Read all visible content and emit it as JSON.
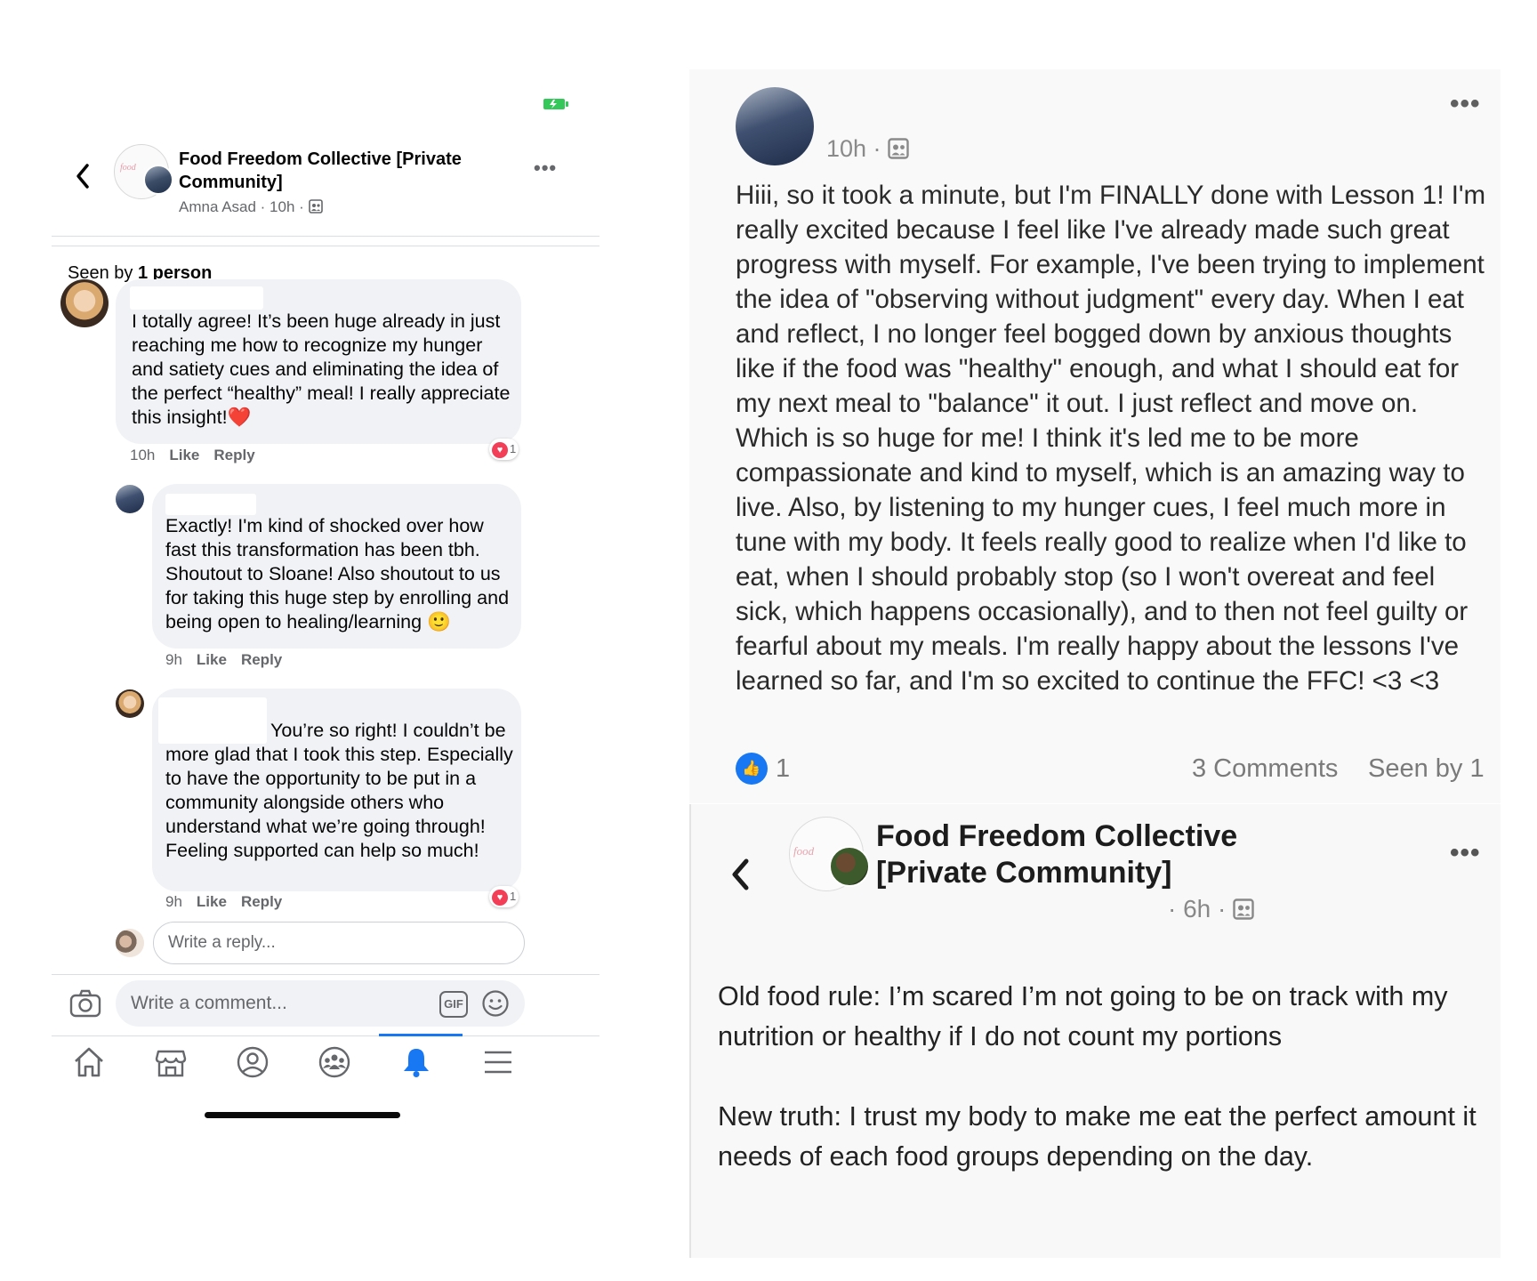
{
  "colors": {
    "accent": "#1877f2",
    "heart": "#f33e58",
    "bubble": "#f0f2f5",
    "secondary_text": "#65676b"
  },
  "left_panel": {
    "header": {
      "group_title": "Food Freedom Collective [Private Community]",
      "meta": "Amna Asad · 10h · ",
      "privacy_icon": "group-members-icon"
    },
    "seen_by": {
      "prefix": "Seen by ",
      "count": "1 person"
    },
    "comments": [
      {
        "text": "I totally agree! It’s been huge already in just reaching me how to recognize my hunger and satiety cues and eliminating the idea of the perfect “healthy” meal! I really appreciate this insight!❤️",
        "time": "10h",
        "like": "Like",
        "reply": "Reply",
        "reaction_count": "1"
      },
      {
        "text": "Exactly! I'm kind of shocked over how fast this transformation has been tbh. Shoutout to Sloane! Also shoutout to us for taking this huge step by enrolling and being open to healing/learning 🙂",
        "time": "9h",
        "like": "Like",
        "reply": "Reply"
      },
      {
        "text": "You’re so right! I couldn’t be more glad that I took this step. Especially to have the opportunity to be put in a community alongside others who understand what we’re going through! Feeling supported can help so much!",
        "time": "9h",
        "like": "Like",
        "reply": "Reply",
        "reaction_count": "1"
      }
    ],
    "reply_placeholder": "Write a reply...",
    "comment_placeholder": "Write a comment...",
    "gif_label": "GIF",
    "tabs": [
      "home-icon",
      "marketplace-icon",
      "profile-icon",
      "groups-icon",
      "notifications-icon",
      "menu-icon"
    ],
    "active_tab": "notifications-icon"
  },
  "right_panel": {
    "post1": {
      "meta": "10h · ",
      "text": "Hiii, so it took a minute, but I'm FINALLY done with Lesson 1! I'm really excited because I feel like I've already made such great progress with myself. For example, I've been trying to implement the idea of \"observing without judgment\" every day. When I eat and reflect, I no longer feel bogged down by anxious thoughts like if the food was \"healthy\" enough, and what I should eat for my next meal to \"balance\" it out. I just reflect and move on. Which is so huge for me! I think it's led me to be more compassionate and kind to myself, which is an amazing way to live. Also, by listening to my hunger cues, I feel much more in tune with my body. It feels really good to realize when I'd like to eat, when I should probably stop (so I won't overeat and feel sick, which happens occasionally), and to then not feel guilty or fearful about my meals. I'm really happy about the lessons I've learned so far, and I'm so excited to continue the FFC! <3 <3",
      "like_count": "1",
      "comments": "3 Comments",
      "seen_by": "Seen by 1"
    },
    "post2": {
      "group_title": "Food Freedom Collective [Private Community]",
      "meta": "· 6h · ",
      "text": "Old food rule: I’m scared I’m not going to be on track with my nutrition or healthy if I do not count my portions\n\nNew truth: I trust my body to make me eat the perfect amount it needs of each food groups depending on the day."
    }
  }
}
